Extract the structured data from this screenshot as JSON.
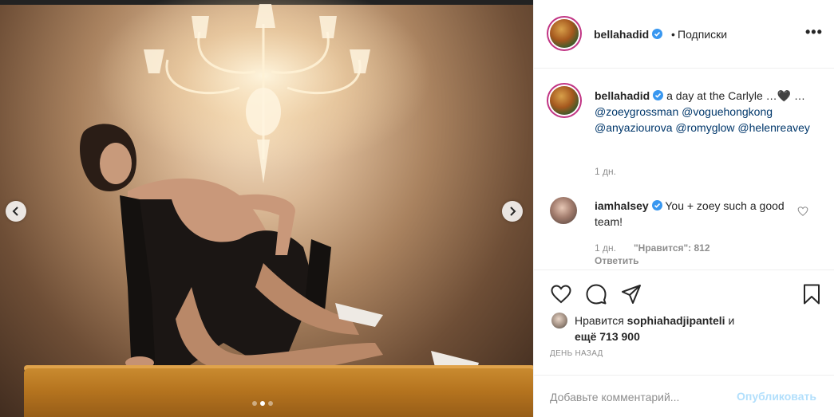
{
  "post": {
    "media": {
      "slide_count": 3,
      "active_slide": 2,
      "prev_icon": "chevron-left-icon",
      "next_icon": "chevron-right-icon"
    },
    "header": {
      "username": "bellahadid",
      "separator": "•",
      "follow_label": "Подписки",
      "more_icon": "more-icon",
      "more_label": "•••"
    },
    "caption": {
      "username": "bellahadid",
      "text": " a day at the Carlyle …🖤 … ",
      "mentions": [
        "@zoeygrossman",
        "@voguehongkong",
        "@anyaziourova",
        "@romyglow",
        "@helenreavey"
      ],
      "time": "1 дн."
    },
    "comment": {
      "username": "iamhalsey",
      "text": " You + zoey such a good team!",
      "time": "1 дн.",
      "likes": "\"Нравится\": 812",
      "reply": "Ответить"
    },
    "actions": {
      "like_icon": "heart-icon",
      "comment_icon": "comment-icon",
      "share_icon": "share-icon",
      "save_icon": "bookmark-icon"
    },
    "likes": {
      "prefix": "Нравится ",
      "user": "sophiahadjipanteli",
      "mid": " и",
      "others": "ещё 713 900"
    },
    "date_label": "ДЕНЬ НАЗАД",
    "comment_input": {
      "placeholder": "Добавьте комментарий...",
      "value": "",
      "publish_label": "Опубликовать"
    },
    "colors": {
      "link": "#00376b",
      "verified": "#3897f0",
      "publish_disabled": "#b2dffc",
      "muted": "#8e8e8e"
    }
  }
}
